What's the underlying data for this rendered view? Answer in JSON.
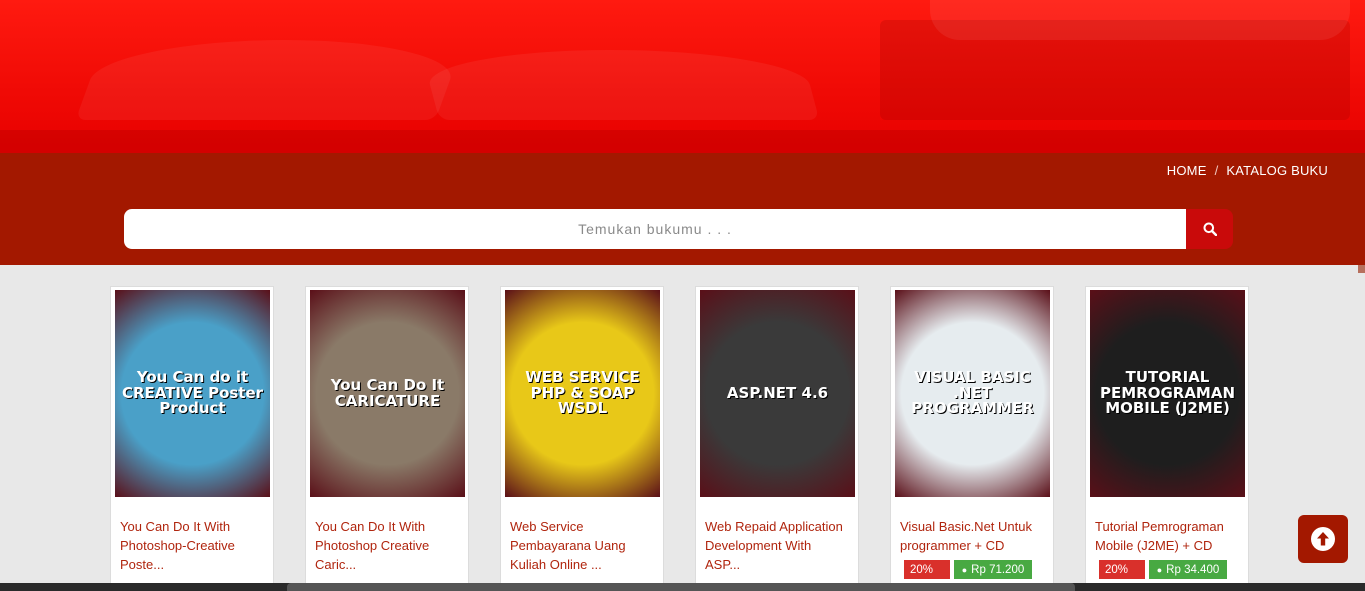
{
  "colors": {
    "accent": "#c90a0a",
    "band": "#a31800",
    "hero": "#f00a05",
    "link": "#b0250e",
    "discount": "#d9302b",
    "price": "#48a942"
  },
  "breadcrumb": {
    "home": "HOME",
    "separator": "/",
    "current": "KATALOG BUKU"
  },
  "search": {
    "placeholder": "Temukan bukumu . . .",
    "icon": "search-icon"
  },
  "books": [
    {
      "title": "You Can Do It With Photoshop-Creative Poste...",
      "cover_text": "You Can do it CREATIVE Poster Product",
      "cover_bg": "#4aa0c8",
      "discount": "",
      "price": ""
    },
    {
      "title": "You Can Do It With Photoshop Creative Caric...",
      "cover_text": "You Can Do It CARICATURE",
      "cover_bg": "#8a7a68",
      "discount": "",
      "price": ""
    },
    {
      "title": "Web Service Pembayarana Uang Kuliah Online ...",
      "cover_text": "WEB SERVICE PHP & SOAP WSDL",
      "cover_bg": "#e8c818",
      "discount": "",
      "price": ""
    },
    {
      "title": "Web Repaid Application Development With ASP...",
      "cover_text": "ASP.NET 4.6",
      "cover_bg": "#3a3a3a",
      "discount": "",
      "price": ""
    },
    {
      "title": "Visual Basic.Net Untuk programmer + CD",
      "cover_text": "VISUAL BASIC .NET PROGRAMMER",
      "cover_bg": "#e6ecef",
      "discount": "20%",
      "price": "Rp 71.200"
    },
    {
      "title": "Tutorial Pemrograman Mobile (J2ME) + CD",
      "cover_text": "TUTORIAL PEMROGRAMAN MOBILE (J2ME)",
      "cover_bg": "#1e1e1e",
      "discount": "20%",
      "price": "Rp 34.400"
    }
  ],
  "scroll_top": {
    "icon": "arrow-up-circle-icon"
  }
}
